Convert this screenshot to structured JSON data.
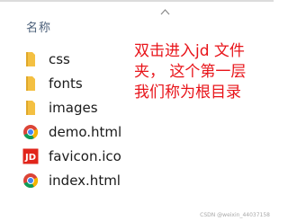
{
  "explorer": {
    "column_header": "名称",
    "files": [
      {
        "name": "css",
        "icon": "folder-icon"
      },
      {
        "name": "fonts",
        "icon": "folder-icon"
      },
      {
        "name": "images",
        "icon": "folder-icon"
      },
      {
        "name": "demo.html",
        "icon": "chrome-icon"
      },
      {
        "name": "favicon.ico",
        "icon": "jd-icon"
      },
      {
        "name": "index.html",
        "icon": "chrome-icon"
      }
    ]
  },
  "annotation": {
    "line1": "双击进入jd 文件",
    "line2": "夹， 这个第一层",
    "line3": "我们称为根目录",
    "color": "#e8141a"
  },
  "watermark": "CSDN @weixin_44037158"
}
